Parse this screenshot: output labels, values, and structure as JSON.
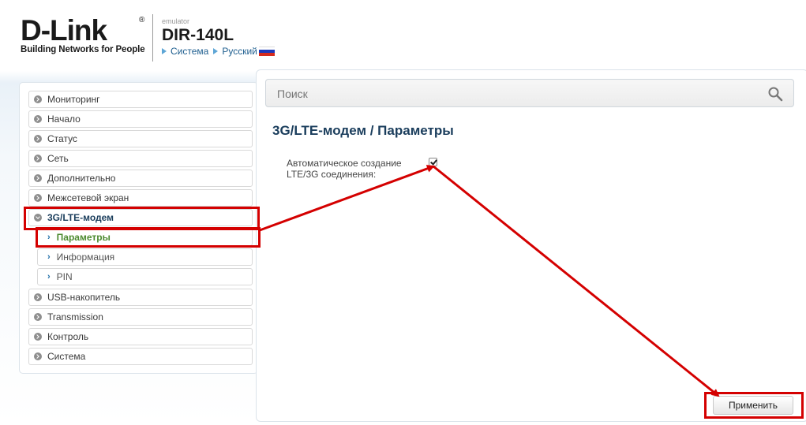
{
  "header": {
    "logo_text": "D-Link",
    "logo_tagline": "Building Networks for People",
    "emulator_label": "emulator",
    "model": "DIR-140L",
    "breadcrumbs": [
      "Система",
      "Русский"
    ]
  },
  "search": {
    "placeholder": "Поиск"
  },
  "sidebar": {
    "items": [
      {
        "label": "Мониторинг"
      },
      {
        "label": "Начало"
      },
      {
        "label": "Статус"
      },
      {
        "label": "Сеть"
      },
      {
        "label": "Дополнительно"
      },
      {
        "label": "Межсетевой экран"
      },
      {
        "label": "3G/LTE-модем",
        "expanded": true
      },
      {
        "label": "USB-накопитель"
      },
      {
        "label": "Transmission"
      },
      {
        "label": "Контроль"
      },
      {
        "label": "Система"
      }
    ],
    "subitems": [
      {
        "label": "Параметры",
        "active": true
      },
      {
        "label": "Информация"
      },
      {
        "label": "PIN"
      }
    ]
  },
  "main": {
    "title": "3G/LTE-модем /  Параметры",
    "auto_connect_label": "Автоматическое создание LTE/3G соединения:",
    "auto_connect_checked": true,
    "apply_label": "Применить"
  },
  "colors": {
    "annotation_red": "#d40000",
    "title_blue": "#1a3d5c",
    "active_green": "#4c8a2f",
    "link_blue": "#1e5e8f"
  }
}
